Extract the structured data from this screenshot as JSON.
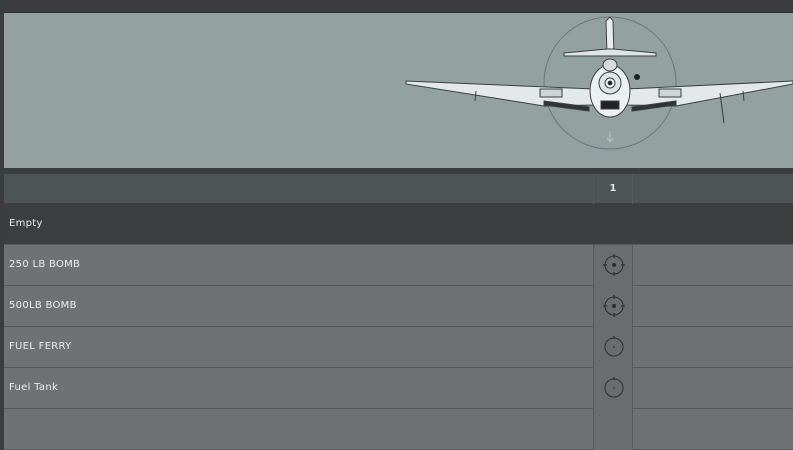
{
  "header": {
    "slot_number": "1"
  },
  "preview": {
    "aircraft_icon": "aircraft-front-view",
    "background_color": "#93a1a1"
  },
  "loadouts": [
    {
      "label": "Empty",
      "selected": true,
      "slot_icon": ""
    },
    {
      "label": "250 LB BOMB",
      "selected": false,
      "slot_icon": "pylon-crosshair-icon"
    },
    {
      "label": "500LB BOMB",
      "selected": false,
      "slot_icon": "pylon-crosshair-icon"
    },
    {
      "label": "FUEL FERRY",
      "selected": false,
      "slot_icon": "pylon-circle-icon"
    },
    {
      "label": "Fuel Tank",
      "selected": false,
      "slot_icon": "pylon-circle-icon"
    },
    {
      "label": "",
      "selected": false,
      "slot_icon": ""
    }
  ]
}
